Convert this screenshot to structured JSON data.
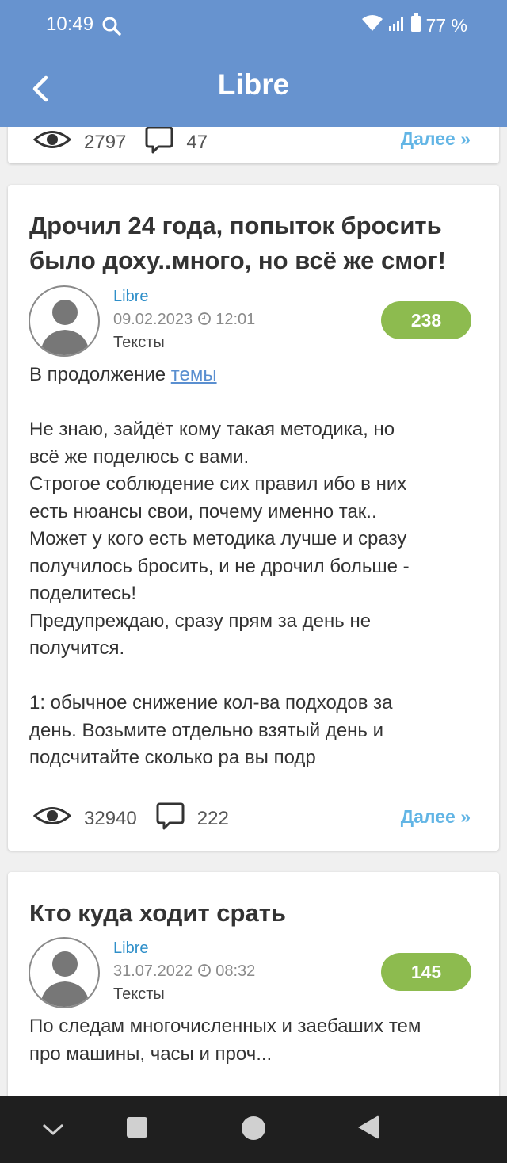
{
  "status_bar": {
    "time": "10:49",
    "battery": "77 %"
  },
  "app_bar": {
    "title": "Libre"
  },
  "prev_post": {
    "views": "2797",
    "comments": "47",
    "more": "Далее »"
  },
  "posts": [
    {
      "title_line1": "Дрочил 24 года, попыток бросить",
      "title_line2": "было доху..много, но всё же смог!",
      "author": "Libre",
      "date": "09.02.2023",
      "time": "12:01",
      "category": "Тексты",
      "rating": "238",
      "intro": "В продолжение ",
      "intro_link": "темы",
      "body": "Не знаю, зайдёт кому такая методика, но\nвсё же поделюсь с вами.\nСтрогое соблюдение сих правил ибо в них\nесть нюансы свои, почему именно так..\nМожет у кого есть методика лучше и сразу\nполучилось бросить, и не дрочил больше -\nподелитесь!\nПредупреждаю, сразу прям за день не\nполучится.\n\n1: обычное снижение кол-ва подходов за\nдень. Возьмите отдельно взятый день и\nподсчитайте сколько ра вы подр",
      "views": "32940",
      "comments": "222",
      "more": "Далее »"
    },
    {
      "title": "Кто куда ходит срать",
      "author": "Libre",
      "date": "31.07.2022",
      "time": "08:32",
      "category": "Тексты",
      "rating": "145",
      "body": "По следам многочисленных и заебаших тем\nпро машины, часы и проч..."
    }
  ],
  "icons": {
    "search": "search-icon",
    "wifi": "wifi-icon",
    "signal": "signal-icon",
    "battery": "battery-icon",
    "back": "back-arrow-icon",
    "eye": "eye-icon",
    "comment": "comment-icon",
    "clock": "clock-icon",
    "avatar": "user-avatar-icon"
  },
  "colors": {
    "primary": "#6793cf",
    "badge": "#8dbb4f",
    "link": "#2f8fc9",
    "more": "#62b5e5"
  }
}
